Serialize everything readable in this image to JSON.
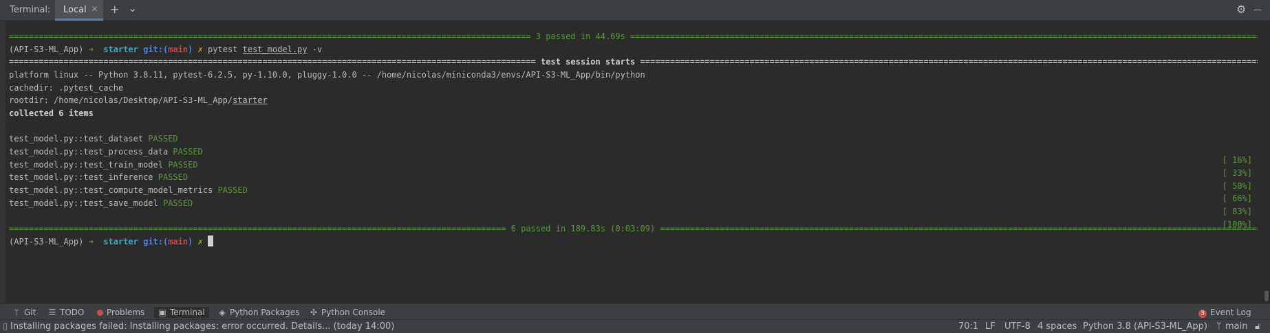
{
  "header": {
    "title": "Terminal:",
    "tab_label": "Local",
    "tab_close": "×",
    "add_symbol": "+",
    "dropdown_symbol": "⌄",
    "settings_symbol": "⚙",
    "minimize_symbol": "—"
  },
  "terminal": {
    "sep1": {
      "left": "=========================================================================================================",
      "text": " 3 passed in 44.69s ",
      "right": "=================================================================================================================================="
    },
    "prompt1": {
      "env": "(API-S3-ML_App)",
      "arrow": " ➜ ",
      "dir": " starter ",
      "git": "git:(",
      "branch": "main",
      "git_close": ")",
      "mark": " ✗ ",
      "cmd": "pytest ",
      "file": "test_model.py",
      "flag": " -v"
    },
    "sep2": {
      "left": "==========================================================================================================",
      "text": " test session starts ",
      "right": "=============================================================================================================================="
    },
    "info": [
      "platform linux -- Python 3.8.11, pytest-6.2.5, py-1.10.0, pluggy-1.0.0 -- /home/nicolas/miniconda3/envs/API-S3-ML_App/bin/python",
      "cachedir: .pytest_cache"
    ],
    "rootdir": {
      "prefix": "rootdir: /home/nicolas/Desktop/API-S3-ML_App/",
      "dir": "starter"
    },
    "collected": "collected 6 items",
    "tests": [
      {
        "name": "test_model.py::test_dataset",
        "status": "PASSED",
        "pct": "[ 16%]"
      },
      {
        "name": "test_model.py::test_process_data",
        "status": "PASSED",
        "pct": "[ 33%]"
      },
      {
        "name": "test_model.py::test_train_model",
        "status": "PASSED",
        "pct": "[ 50%]"
      },
      {
        "name": "test_model.py::test_inference",
        "status": "PASSED",
        "pct": "[ 66%]"
      },
      {
        "name": "test_model.py::test_compute_model_metrics",
        "status": "PASSED",
        "pct": "[ 83%]"
      },
      {
        "name": "test_model.py::test_save_model",
        "status": "PASSED",
        "pct": "[100%]"
      }
    ],
    "sep3": {
      "left": "====================================================================================================",
      "text": " 6 passed in 189.83s (0:03:09) ",
      "right": "================================================================================================================================"
    },
    "prompt2": {
      "env": "(API-S3-ML_App)",
      "arrow": " ➜ ",
      "dir": " starter ",
      "git": "git:(",
      "branch": "main",
      "git_close": ")",
      "mark": " ✗ "
    }
  },
  "toolbar": {
    "git": "Git",
    "todo": "TODO",
    "problems": "Problems",
    "terminal": "Terminal",
    "python_packages": "Python Packages",
    "python_console": "Python Console",
    "event_log": "Event Log",
    "event_log_count": "3"
  },
  "statusbar": {
    "message": "Installing packages failed: Installing packages: error occurred. Details... (today 14:00)",
    "position": "70:1",
    "line_sep": "LF",
    "encoding": "UTF-8",
    "indent": "4 spaces",
    "interpreter": "Python 3.8 (API-S3-ML_App)",
    "branch": "main"
  },
  "colors": {
    "accent": "#4a88c7",
    "passed": "#5a9a3a",
    "error": "#c94f4f"
  }
}
